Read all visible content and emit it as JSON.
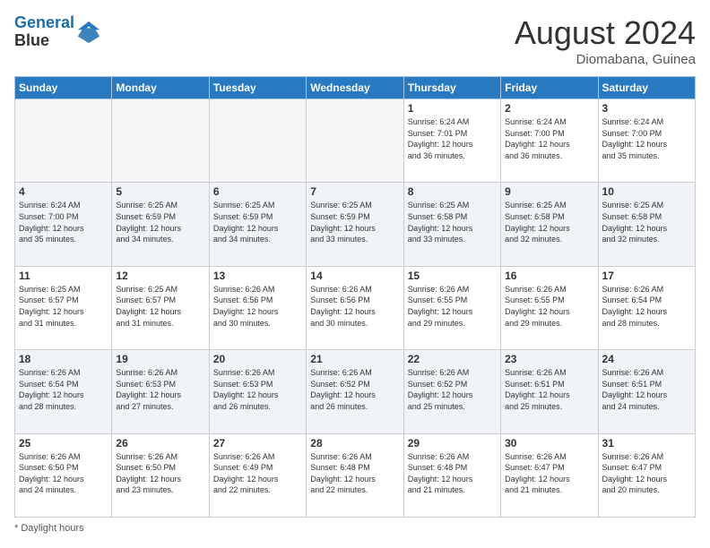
{
  "logo": {
    "line1": "General",
    "line2": "Blue"
  },
  "title": "August 2024",
  "subtitle": "Diomabana, Guinea",
  "footer": "Daylight hours",
  "days_of_week": [
    "Sunday",
    "Monday",
    "Tuesday",
    "Wednesday",
    "Thursday",
    "Friday",
    "Saturday"
  ],
  "weeks": [
    [
      {
        "day": "",
        "info": ""
      },
      {
        "day": "",
        "info": ""
      },
      {
        "day": "",
        "info": ""
      },
      {
        "day": "",
        "info": ""
      },
      {
        "day": "1",
        "info": "Sunrise: 6:24 AM\nSunset: 7:01 PM\nDaylight: 12 hours\nand 36 minutes."
      },
      {
        "day": "2",
        "info": "Sunrise: 6:24 AM\nSunset: 7:00 PM\nDaylight: 12 hours\nand 36 minutes."
      },
      {
        "day": "3",
        "info": "Sunrise: 6:24 AM\nSunset: 7:00 PM\nDaylight: 12 hours\nand 35 minutes."
      }
    ],
    [
      {
        "day": "4",
        "info": "Sunrise: 6:24 AM\nSunset: 7:00 PM\nDaylight: 12 hours\nand 35 minutes."
      },
      {
        "day": "5",
        "info": "Sunrise: 6:25 AM\nSunset: 6:59 PM\nDaylight: 12 hours\nand 34 minutes."
      },
      {
        "day": "6",
        "info": "Sunrise: 6:25 AM\nSunset: 6:59 PM\nDaylight: 12 hours\nand 34 minutes."
      },
      {
        "day": "7",
        "info": "Sunrise: 6:25 AM\nSunset: 6:59 PM\nDaylight: 12 hours\nand 33 minutes."
      },
      {
        "day": "8",
        "info": "Sunrise: 6:25 AM\nSunset: 6:58 PM\nDaylight: 12 hours\nand 33 minutes."
      },
      {
        "day": "9",
        "info": "Sunrise: 6:25 AM\nSunset: 6:58 PM\nDaylight: 12 hours\nand 32 minutes."
      },
      {
        "day": "10",
        "info": "Sunrise: 6:25 AM\nSunset: 6:58 PM\nDaylight: 12 hours\nand 32 minutes."
      }
    ],
    [
      {
        "day": "11",
        "info": "Sunrise: 6:25 AM\nSunset: 6:57 PM\nDaylight: 12 hours\nand 31 minutes."
      },
      {
        "day": "12",
        "info": "Sunrise: 6:25 AM\nSunset: 6:57 PM\nDaylight: 12 hours\nand 31 minutes."
      },
      {
        "day": "13",
        "info": "Sunrise: 6:26 AM\nSunset: 6:56 PM\nDaylight: 12 hours\nand 30 minutes."
      },
      {
        "day": "14",
        "info": "Sunrise: 6:26 AM\nSunset: 6:56 PM\nDaylight: 12 hours\nand 30 minutes."
      },
      {
        "day": "15",
        "info": "Sunrise: 6:26 AM\nSunset: 6:55 PM\nDaylight: 12 hours\nand 29 minutes."
      },
      {
        "day": "16",
        "info": "Sunrise: 6:26 AM\nSunset: 6:55 PM\nDaylight: 12 hours\nand 29 minutes."
      },
      {
        "day": "17",
        "info": "Sunrise: 6:26 AM\nSunset: 6:54 PM\nDaylight: 12 hours\nand 28 minutes."
      }
    ],
    [
      {
        "day": "18",
        "info": "Sunrise: 6:26 AM\nSunset: 6:54 PM\nDaylight: 12 hours\nand 28 minutes."
      },
      {
        "day": "19",
        "info": "Sunrise: 6:26 AM\nSunset: 6:53 PM\nDaylight: 12 hours\nand 27 minutes."
      },
      {
        "day": "20",
        "info": "Sunrise: 6:26 AM\nSunset: 6:53 PM\nDaylight: 12 hours\nand 26 minutes."
      },
      {
        "day": "21",
        "info": "Sunrise: 6:26 AM\nSunset: 6:52 PM\nDaylight: 12 hours\nand 26 minutes."
      },
      {
        "day": "22",
        "info": "Sunrise: 6:26 AM\nSunset: 6:52 PM\nDaylight: 12 hours\nand 25 minutes."
      },
      {
        "day": "23",
        "info": "Sunrise: 6:26 AM\nSunset: 6:51 PM\nDaylight: 12 hours\nand 25 minutes."
      },
      {
        "day": "24",
        "info": "Sunrise: 6:26 AM\nSunset: 6:51 PM\nDaylight: 12 hours\nand 24 minutes."
      }
    ],
    [
      {
        "day": "25",
        "info": "Sunrise: 6:26 AM\nSunset: 6:50 PM\nDaylight: 12 hours\nand 24 minutes."
      },
      {
        "day": "26",
        "info": "Sunrise: 6:26 AM\nSunset: 6:50 PM\nDaylight: 12 hours\nand 23 minutes."
      },
      {
        "day": "27",
        "info": "Sunrise: 6:26 AM\nSunset: 6:49 PM\nDaylight: 12 hours\nand 22 minutes."
      },
      {
        "day": "28",
        "info": "Sunrise: 6:26 AM\nSunset: 6:48 PM\nDaylight: 12 hours\nand 22 minutes."
      },
      {
        "day": "29",
        "info": "Sunrise: 6:26 AM\nSunset: 6:48 PM\nDaylight: 12 hours\nand 21 minutes."
      },
      {
        "day": "30",
        "info": "Sunrise: 6:26 AM\nSunset: 6:47 PM\nDaylight: 12 hours\nand 21 minutes."
      },
      {
        "day": "31",
        "info": "Sunrise: 6:26 AM\nSunset: 6:47 PM\nDaylight: 12 hours\nand 20 minutes."
      }
    ]
  ]
}
